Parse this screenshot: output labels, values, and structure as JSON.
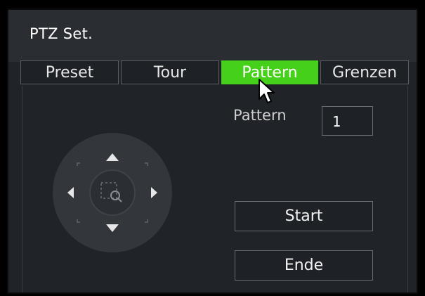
{
  "window": {
    "title": "PTZ Set."
  },
  "tabs": [
    {
      "label": "Preset",
      "active": false
    },
    {
      "label": "Tour",
      "active": false
    },
    {
      "label": "Pattern",
      "active": true
    },
    {
      "label": "Grenzen",
      "active": false
    }
  ],
  "pattern": {
    "label": "Pattern",
    "value": "1"
  },
  "buttons": {
    "start": "Start",
    "end": "Ende"
  },
  "colors": {
    "active_tab": "#45d11a",
    "background": "#202327",
    "titlebar": "#2a2d31"
  },
  "icons": {
    "dpad": "directional-pad",
    "center": "zoom-to-area-icon",
    "cursor": "mouse-pointer"
  }
}
